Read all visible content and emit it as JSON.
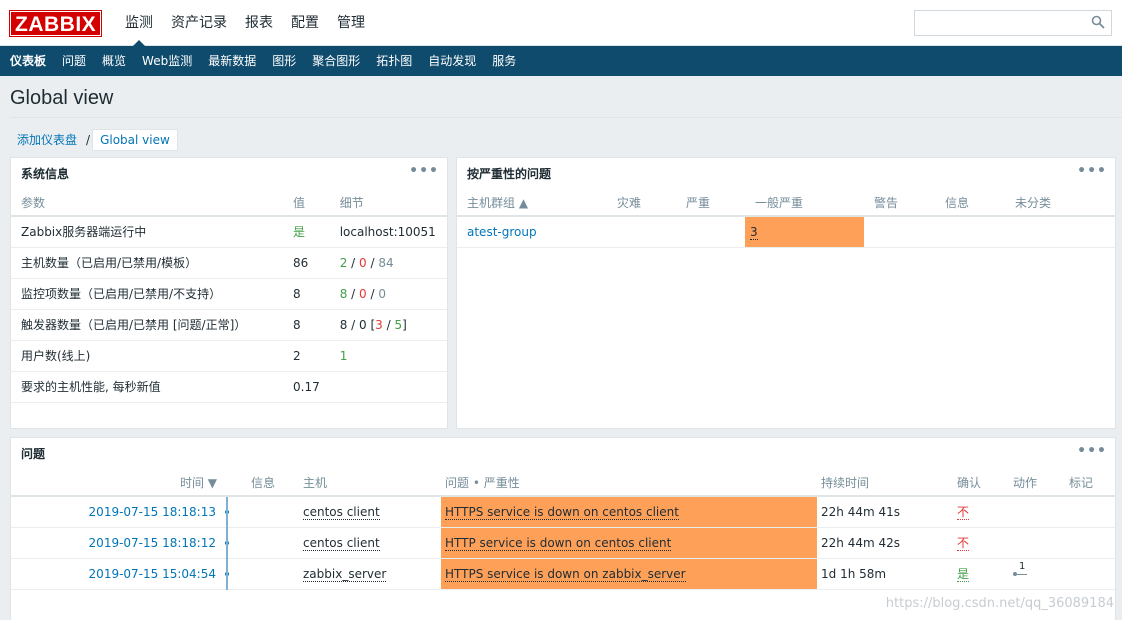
{
  "logo": "ZABBIX",
  "top_menu": [
    "监测",
    "资产记录",
    "报表",
    "配置",
    "管理"
  ],
  "search": {
    "placeholder": ""
  },
  "sub_menu": [
    "仪表板",
    "问题",
    "概览",
    "Web监测",
    "最新数据",
    "图形",
    "聚合图形",
    "拓扑图",
    "自动发现",
    "服务"
  ],
  "page_title": "Global view",
  "breadcrumb": {
    "parent": "添加仪表盘",
    "separator": "/",
    "current": "Global view"
  },
  "sysinfo": {
    "title": "系统信息",
    "headers": [
      "参数",
      "值",
      "细节"
    ],
    "rows": [
      {
        "param": "Zabbix服务器端运行中",
        "value": "是",
        "detail": "localhost:10051"
      },
      {
        "param": "主机数量（已启用/已禁用/模板）",
        "value": "86",
        "d1": "2",
        "d2": "0",
        "d3": "84"
      },
      {
        "param": "监控项数量（已启用/已禁用/不支持）",
        "value": "8",
        "d1": "8",
        "d2": "0",
        "d3": "0"
      },
      {
        "param": "触发器数量（已启用/已禁用 [问题/正常]）",
        "value": "8",
        "d_pre": "8 / 0 [",
        "d1": "3",
        "d2": "5",
        "d_post": "]"
      },
      {
        "param": "用户数(线上)",
        "value": "2",
        "d1": "1"
      },
      {
        "param": "要求的主机性能, 每秒新值",
        "value": "0.17"
      }
    ]
  },
  "severity": {
    "title": "按严重性的问题",
    "headers": [
      "主机群组 ▲",
      "灾难",
      "严重",
      "一般严重",
      "警告",
      "信息",
      "未分类"
    ],
    "rows": [
      {
        "group": "atest-group",
        "average": "3"
      }
    ]
  },
  "problems": {
    "title": "问题",
    "headers": [
      "时间 ▼",
      "信息",
      "主机",
      "问题 • 严重性",
      "持续时间",
      "确认",
      "动作",
      "标记"
    ],
    "rows": [
      {
        "time": "2019-07-15 18:18:13",
        "host": "centos client",
        "problem": "HTTPS service is down on centos client",
        "duration": "22h 44m 41s",
        "ack": "不",
        "action": ""
      },
      {
        "time": "2019-07-15 18:18:12",
        "host": "centos client",
        "problem": "HTTP service is down on centos client",
        "duration": "22h 44m 42s",
        "ack": "不",
        "action": ""
      },
      {
        "time": "2019-07-15 15:04:54",
        "host": "zabbix_server",
        "problem": "HTTPS service is down on zabbix_server",
        "duration": "1d 1h 58m",
        "ack": "是",
        "action": "1"
      }
    ]
  },
  "colors": {
    "header_bg": "#0f4b6d",
    "average": "#ffa059",
    "logo": "#d40000"
  },
  "watermark": "https://blog.csdn.net/qq_36089184"
}
